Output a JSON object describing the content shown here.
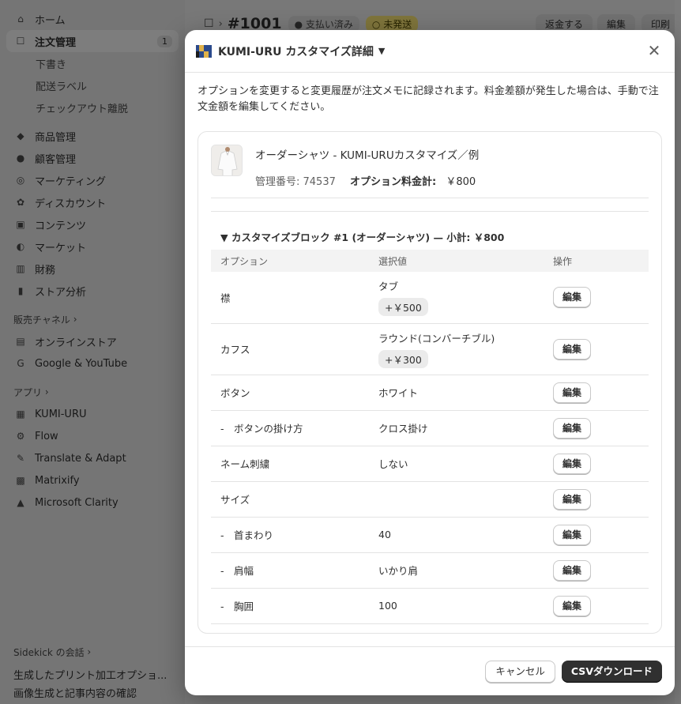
{
  "sidebar": {
    "main": [
      {
        "label": "ホーム",
        "icon": "home-icon",
        "glyph": "⌂"
      },
      {
        "label": "注文管理",
        "icon": "inbox-icon",
        "glyph": "☐",
        "badge": "1",
        "active": true
      }
    ],
    "order_sub": [
      "下書き",
      "配送ラベル",
      "チェックアウト離脱"
    ],
    "more": [
      {
        "label": "商品管理",
        "icon": "tag-icon",
        "glyph": "◆"
      },
      {
        "label": "顧客管理",
        "icon": "person-icon",
        "glyph": "●"
      },
      {
        "label": "マーケティング",
        "icon": "target-icon",
        "glyph": "◎"
      },
      {
        "label": "ディスカウント",
        "icon": "discount-icon",
        "glyph": "✿"
      },
      {
        "label": "コンテンツ",
        "icon": "content-icon",
        "glyph": "▣"
      },
      {
        "label": "マーケット",
        "icon": "globe-icon",
        "glyph": "◐"
      },
      {
        "label": "財務",
        "icon": "bank-icon",
        "glyph": "▥"
      },
      {
        "label": "ストア分析",
        "icon": "bar-chart-icon",
        "glyph": "▮"
      }
    ],
    "sales_channels_label": "販売チャネル",
    "sales_channels": [
      {
        "label": "オンラインストア",
        "icon": "store-icon",
        "glyph": "▤"
      },
      {
        "label": "Google & YouTube",
        "icon": "google-icon",
        "glyph": "G"
      }
    ],
    "apps_label": "アプリ",
    "apps": [
      {
        "label": "KUMI-URU",
        "icon": "kumi-uru-icon",
        "glyph": "▦"
      },
      {
        "label": "Flow",
        "icon": "flow-icon",
        "glyph": "⚙"
      },
      {
        "label": "Translate & Adapt",
        "icon": "translate-icon",
        "glyph": "✎"
      },
      {
        "label": "Matrixify",
        "icon": "matrixify-icon",
        "glyph": "▩"
      },
      {
        "label": "Microsoft Clarity",
        "icon": "clarity-icon",
        "glyph": "▲"
      }
    ],
    "sidekick_label": "Sidekick の会話",
    "sidekick_items": [
      "生成したプリント加工オプショ...",
      "画像生成と記事内容の確認"
    ]
  },
  "topbar": {
    "order_number": "#1001",
    "payment_status": "支払い済み",
    "fulfillment_status": "未発送",
    "refund_label": "返金する",
    "edit_label": "編集",
    "print_label": "印刷"
  },
  "modal": {
    "title": "KUMI-URU カスタマイズ詳細",
    "notice": "オプションを変更すると変更履歴が注文メモに記録されます。料金差額が発生した場合は、手動で注文金額を編集してください。",
    "product": {
      "name": "オーダーシャツ - KUMI-URUカスタマイズ／例",
      "management_label": "管理番号: 74537",
      "option_total_label": "オプション料金計:",
      "option_total_value": "￥800"
    },
    "block_title": "▼ カスタマイズブロック #1 (オーダーシャツ) — 小計: ￥800",
    "table_headers": {
      "option": "オプション",
      "value": "選択値",
      "action": "操作"
    },
    "rows": [
      {
        "option": "襟",
        "value": "タブ",
        "price": "+￥500"
      },
      {
        "option": "カフス",
        "value": "ラウンド(コンバーチブル)",
        "price": "+￥300"
      },
      {
        "option": "ボタン",
        "value": "ホワイト"
      },
      {
        "option": "-　ボタンの掛け方",
        "value": "クロス掛け"
      },
      {
        "option": "ネーム刺繍",
        "value": "しない"
      },
      {
        "option": "サイズ",
        "value": ""
      },
      {
        "option": "-　首まわり",
        "value": "40"
      },
      {
        "option": "-　肩幅",
        "value": "いかり肩"
      },
      {
        "option": "-　胸囲",
        "value": "100"
      }
    ],
    "edit_label": "編集",
    "cancel_label": "キャンセル",
    "download_label": "CSVダウンロード"
  },
  "colors": {
    "primary_button": "#303030",
    "unfulfilled_badge": "#ffeb78",
    "overlay": "rgba(0,0,0,0.5)"
  }
}
